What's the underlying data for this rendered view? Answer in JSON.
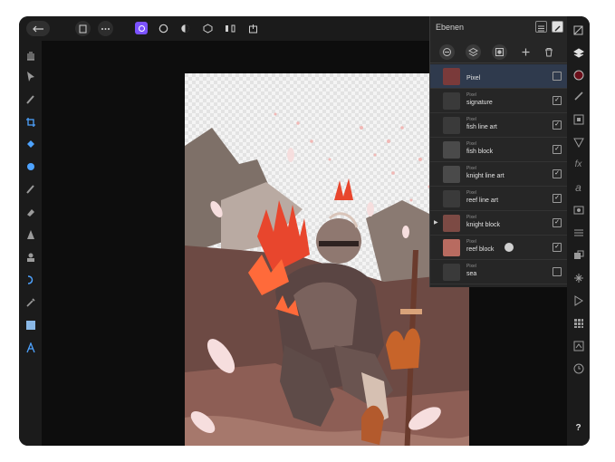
{
  "panel": {
    "title": "Ebenen",
    "layers": [
      {
        "kind": "",
        "name": "Pixel",
        "checked": false,
        "thumb_color": "#7a3a3a"
      },
      {
        "kind": "Pixel",
        "name": "signature",
        "checked": true,
        "thumb_color": "#3a3a3a"
      },
      {
        "kind": "Pixel",
        "name": "fish line art",
        "checked": true,
        "thumb_color": "#3a3a3a"
      },
      {
        "kind": "Pixel",
        "name": "fish block",
        "checked": true,
        "thumb_color": "#4a4a4a"
      },
      {
        "kind": "Pixel",
        "name": "knight line art",
        "checked": true,
        "thumb_color": "#4a4a4a"
      },
      {
        "kind": "Pixel",
        "name": "reef line art",
        "checked": true,
        "thumb_color": "#3a3a3a"
      },
      {
        "kind": "Pixel",
        "name": "knight block",
        "checked": true,
        "thumb_color": "#7c4a44"
      },
      {
        "kind": "Pixel",
        "name": "reef block",
        "checked": true,
        "thumb_color": "#b86b60"
      },
      {
        "kind": "Pixel",
        "name": "sea",
        "checked": false,
        "thumb_color": "#3a3a3a"
      }
    ]
  },
  "icons": {
    "top": [
      "back-icon",
      "document-icon",
      "more-icon",
      "photo-persona-icon",
      "circle-icon",
      "color-icon",
      "cube-icon",
      "split-icon",
      "export-icon"
    ],
    "left": [
      "hand-icon",
      "move-icon",
      "brush-icon",
      "crop-icon",
      "fill-icon",
      "selection-brush-icon",
      "paint-brush-icon",
      "eraser-icon",
      "dodge-icon",
      "clone-icon",
      "smudge-icon",
      "color-picker-icon",
      "rectangle-icon",
      "text-icon"
    ],
    "right": [
      "layers-icon",
      "color-icon",
      "brushes-icon",
      "navigator-icon",
      "adjustments-icon",
      "effects-icon",
      "text-style-icon",
      "channels-icon",
      "history-icon",
      "transform-icon",
      "stock-icon",
      "swatches-icon",
      "assets-icon",
      "macro-icon",
      "help-icon"
    ]
  },
  "help_label": "?",
  "colors": {
    "accent": "#7b52ff",
    "panel": "#262626",
    "bg": "#0d0d0d"
  }
}
